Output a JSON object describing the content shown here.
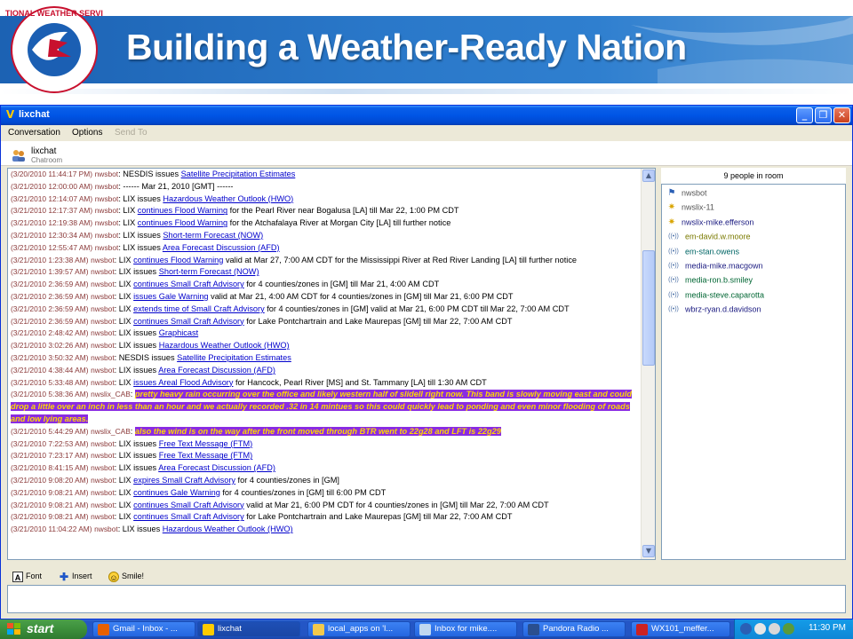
{
  "banner": {
    "title": "Building a Weather-Ready Nation",
    "logo_text": "NATIONAL WEATHER SERVICE"
  },
  "window": {
    "title": "lixchat",
    "menu": [
      "Conversation",
      "Options",
      "Send To"
    ],
    "room_name": "lixchat",
    "room_type": "Chatroom"
  },
  "chat": {
    "lines": [
      {
        "ts": "(3/20/2010 11:44:17 PM)",
        "user": "nwsbot",
        "pre": "NESDIS issues ",
        "link": "Satellite Precipitation Estimates",
        "post": ""
      },
      {
        "ts": "(3/21/2010 12:00:00 AM)",
        "user": "nwsbot",
        "pre": "------ Mar 21, 2010 [GMT] ------",
        "link": "",
        "post": ""
      },
      {
        "ts": "(3/21/2010 12:14:07 AM)",
        "user": "nwsbot",
        "pre": "LIX issues ",
        "link": "Hazardous Weather Outlook (HWO)",
        "post": ""
      },
      {
        "ts": "(3/21/2010 12:17:37 AM)",
        "user": "nwsbot",
        "pre": "LIX ",
        "link": "continues Flood Warning",
        "post": " for the Pearl River near Bogalusa [LA] till Mar 22, 1:00 PM CDT"
      },
      {
        "ts": "(3/21/2010 12:19:38 AM)",
        "user": "nwsbot",
        "pre": "LIX ",
        "link": "continues Flood Warning",
        "post": " for the Atchafalaya River at Morgan City [LA] till further notice"
      },
      {
        "ts": "(3/21/2010 12:30:34 AM)",
        "user": "nwsbot",
        "pre": "LIX issues ",
        "link": "Short-term Forecast (NOW)",
        "post": ""
      },
      {
        "ts": "(3/21/2010 12:55:47 AM)",
        "user": "nwsbot",
        "pre": "LIX issues ",
        "link": "Area Forecast Discussion (AFD)",
        "post": ""
      },
      {
        "ts": "(3/21/2010 1:23:38 AM)",
        "user": "nwsbot",
        "pre": "LIX ",
        "link": "continues Flood Warning",
        "post": " valid at Mar 27, 7:00 AM CDT for the Mississippi River at Red River Landing [LA] till further notice",
        "wrap": true
      },
      {
        "ts": "(3/21/2010 1:39:57 AM)",
        "user": "nwsbot",
        "pre": "LIX issues ",
        "link": "Short-term Forecast (NOW)",
        "post": ""
      },
      {
        "ts": "(3/21/2010 2:36:59 AM)",
        "user": "nwsbot",
        "pre": "LIX ",
        "link": "continues Small Craft Advisory",
        "post": " for  4 counties/zones in [GM] till Mar 21, 4:00 AM CDT"
      },
      {
        "ts": "(3/21/2010 2:36:59 AM)",
        "user": "nwsbot",
        "pre": "LIX ",
        "link": "issues Gale Warning",
        "post": " valid at Mar 21, 4:00 AM CDT for  4 counties/zones in [GM] till Mar 21, 6:00 PM CDT"
      },
      {
        "ts": "(3/21/2010 2:36:59 AM)",
        "user": "nwsbot",
        "pre": "LIX ",
        "link": "extends time of Small Craft Advisory",
        "post": " for  4 counties/zones in [GM] valid at Mar 21, 6:00 PM CDT till Mar 22, 7:00 AM CDT"
      },
      {
        "ts": "(3/21/2010 2:36:59 AM)",
        "user": "nwsbot",
        "pre": "LIX ",
        "link": "continues Small Craft Advisory",
        "post": " for  Lake Pontchartrain and Lake Maurepas [GM] till Mar 22, 7:00 AM CDT"
      },
      {
        "ts": "(3/21/2010 2:48:42 AM)",
        "user": "nwsbot",
        "pre": "LIX issues ",
        "link": "Graphicast",
        "post": ""
      },
      {
        "ts": "(3/21/2010 3:02:26 AM)",
        "user": "nwsbot",
        "pre": "LIX issues ",
        "link": "Hazardous Weather Outlook (HWO)",
        "post": ""
      },
      {
        "ts": "(3/21/2010 3:50:32 AM)",
        "user": "nwsbot",
        "pre": "NESDIS issues ",
        "link": "Satellite Precipitation Estimates",
        "post": ""
      },
      {
        "ts": "(3/21/2010 4:38:44 AM)",
        "user": "nwsbot",
        "pre": "LIX issues ",
        "link": "Area Forecast Discussion (AFD)",
        "post": ""
      },
      {
        "ts": "(3/21/2010 5:33:48 AM)",
        "user": "nwsbot",
        "pre": "LIX ",
        "link": "issues Areal Flood Advisory",
        "post": " for  Hancock, Pearl River [MS] and St. Tammany [LA] till 1:30 AM CDT"
      },
      {
        "ts": "(3/21/2010 5:38:36 AM)",
        "user": "nwslix_CAB",
        "highlight": "pretty heavy rain occurring over the office and likely western half of slidell right now. This band is slowly moving east and could drop a little over an inch in less than an hour and we actually recorded .32 in 14 mintues so this could quickly lead to ponding and even minor flooding of roads and low lying areas."
      },
      {
        "ts": "(3/21/2010 5:44:29 AM)",
        "user": "nwslix_CAB",
        "highlight": "also the wind is on the way after the front moved through BTR went to 22g28 and LFT is 22g29"
      },
      {
        "ts": "(3/21/2010 7:22:53 AM)",
        "user": "nwsbot",
        "pre": "LIX issues ",
        "link": "Free Text Message (FTM)",
        "post": ""
      },
      {
        "ts": "(3/21/2010 7:23:17 AM)",
        "user": "nwsbot",
        "pre": "LIX issues ",
        "link": "Free Text Message (FTM)",
        "post": ""
      },
      {
        "ts": "(3/21/2010 8:41:15 AM)",
        "user": "nwsbot",
        "pre": "LIX issues ",
        "link": "Area Forecast Discussion (AFD)",
        "post": ""
      },
      {
        "ts": "(3/21/2010 9:08:20 AM)",
        "user": "nwsbot",
        "pre": "LIX ",
        "link": "expires Small Craft Advisory",
        "post": " for  4 counties/zones in [GM]"
      },
      {
        "ts": "(3/21/2010 9:08:21 AM)",
        "user": "nwsbot",
        "pre": "LIX ",
        "link": "continues Gale Warning",
        "post": " for  4 counties/zones in [GM] till 6:00 PM CDT"
      },
      {
        "ts": "(3/21/2010 9:08:21 AM)",
        "user": "nwsbot",
        "pre": "LIX ",
        "link": "continues Small Craft Advisory",
        "post": " valid at Mar 21, 6:00 PM CDT for  4 counties/zones in [GM] till Mar 22, 7:00 AM CDT"
      },
      {
        "ts": "(3/21/2010 9:08:21 AM)",
        "user": "nwsbot",
        "pre": "LIX ",
        "link": "continues Small Craft Advisory",
        "post": " for  Lake Pontchartrain and Lake Maurepas [GM] till Mar 22, 7:00 AM CDT"
      },
      {
        "ts": "(3/21/2010 11:04:22 AM)",
        "user": "nwsbot",
        "pre": "LIX issues ",
        "link": "Hazardous Weather Outlook (HWO)",
        "post": ""
      }
    ]
  },
  "people": {
    "count_label": "9 people in room",
    "list": [
      {
        "name": "nwsbot",
        "icon": "bot-flag-icon",
        "color": "#555555"
      },
      {
        "name": "nwslix-11",
        "icon": "star-icon",
        "color": "#555555"
      },
      {
        "name": "nwslix-mike.efferson",
        "icon": "star-icon",
        "color": "#1a1a80"
      },
      {
        "name": "em-david.w.moore",
        "icon": "signal-icon",
        "color": "#7a7a00"
      },
      {
        "name": "em-stan.owens",
        "icon": "signal-icon",
        "color": "#006666"
      },
      {
        "name": "media-mike.macgown",
        "icon": "signal-icon",
        "color": "#1a1a80"
      },
      {
        "name": "media-ron.b.smiley",
        "icon": "signal-icon",
        "color": "#006633"
      },
      {
        "name": "media-steve.caparotta",
        "icon": "signal-icon",
        "color": "#006633"
      },
      {
        "name": "wbrz-ryan.d.davidson",
        "icon": "signal-icon",
        "color": "#1a1a80"
      }
    ]
  },
  "composer": {
    "font_label": "Font",
    "insert_label": "Insert",
    "smile_label": "Smile!",
    "input_value": ""
  },
  "taskbar": {
    "start_label": "start",
    "tasks": [
      {
        "label": "Gmail - Inbox - ...",
        "icon": "firefox-icon",
        "color": "#e66000"
      },
      {
        "label": "lixchat",
        "icon": "lixchat-icon",
        "color": "#ffcc00",
        "active": true
      },
      {
        "label": "local_apps on 'l...",
        "icon": "folder-icon",
        "color": "#f2c94c"
      },
      {
        "label": "Inbox for mike....",
        "icon": "mail-icon",
        "color": "#c0d8f0"
      },
      {
        "label": "Pandora Radio ...",
        "icon": "pandora-icon",
        "color": "#2a4f8f"
      },
      {
        "label": "WX101_meffer...",
        "icon": "pdf-icon",
        "color": "#cc2222"
      }
    ],
    "clock": "11:30 PM"
  }
}
